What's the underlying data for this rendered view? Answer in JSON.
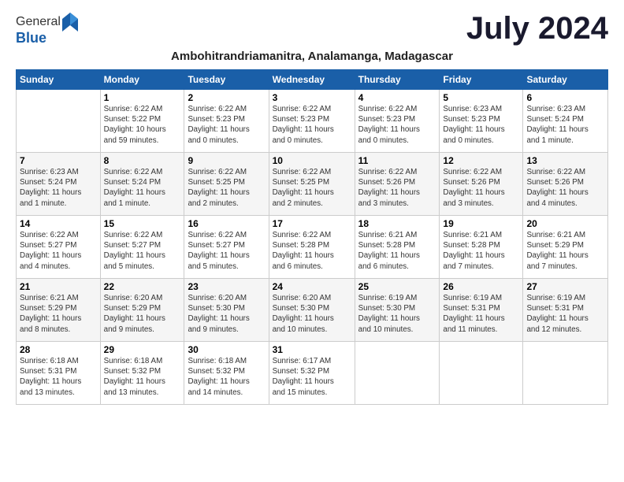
{
  "logo": {
    "general": "General",
    "blue": "Blue"
  },
  "title": "July 2024",
  "subtitle": "Ambohitrandriamanitra, Analamanga, Madagascar",
  "days_of_week": [
    "Sunday",
    "Monday",
    "Tuesday",
    "Wednesday",
    "Thursday",
    "Friday",
    "Saturday"
  ],
  "weeks": [
    [
      {
        "day": "",
        "info": ""
      },
      {
        "day": "1",
        "info": "Sunrise: 6:22 AM\nSunset: 5:22 PM\nDaylight: 10 hours\nand 59 minutes."
      },
      {
        "day": "2",
        "info": "Sunrise: 6:22 AM\nSunset: 5:23 PM\nDaylight: 11 hours\nand 0 minutes."
      },
      {
        "day": "3",
        "info": "Sunrise: 6:22 AM\nSunset: 5:23 PM\nDaylight: 11 hours\nand 0 minutes."
      },
      {
        "day": "4",
        "info": "Sunrise: 6:22 AM\nSunset: 5:23 PM\nDaylight: 11 hours\nand 0 minutes."
      },
      {
        "day": "5",
        "info": "Sunrise: 6:23 AM\nSunset: 5:23 PM\nDaylight: 11 hours\nand 0 minutes."
      },
      {
        "day": "6",
        "info": "Sunrise: 6:23 AM\nSunset: 5:24 PM\nDaylight: 11 hours\nand 1 minute."
      }
    ],
    [
      {
        "day": "7",
        "info": "Sunrise: 6:23 AM\nSunset: 5:24 PM\nDaylight: 11 hours\nand 1 minute."
      },
      {
        "day": "8",
        "info": "Sunrise: 6:22 AM\nSunset: 5:24 PM\nDaylight: 11 hours\nand 1 minute."
      },
      {
        "day": "9",
        "info": "Sunrise: 6:22 AM\nSunset: 5:25 PM\nDaylight: 11 hours\nand 2 minutes."
      },
      {
        "day": "10",
        "info": "Sunrise: 6:22 AM\nSunset: 5:25 PM\nDaylight: 11 hours\nand 2 minutes."
      },
      {
        "day": "11",
        "info": "Sunrise: 6:22 AM\nSunset: 5:26 PM\nDaylight: 11 hours\nand 3 minutes."
      },
      {
        "day": "12",
        "info": "Sunrise: 6:22 AM\nSunset: 5:26 PM\nDaylight: 11 hours\nand 3 minutes."
      },
      {
        "day": "13",
        "info": "Sunrise: 6:22 AM\nSunset: 5:26 PM\nDaylight: 11 hours\nand 4 minutes."
      }
    ],
    [
      {
        "day": "14",
        "info": "Sunrise: 6:22 AM\nSunset: 5:27 PM\nDaylight: 11 hours\nand 4 minutes."
      },
      {
        "day": "15",
        "info": "Sunrise: 6:22 AM\nSunset: 5:27 PM\nDaylight: 11 hours\nand 5 minutes."
      },
      {
        "day": "16",
        "info": "Sunrise: 6:22 AM\nSunset: 5:27 PM\nDaylight: 11 hours\nand 5 minutes."
      },
      {
        "day": "17",
        "info": "Sunrise: 6:22 AM\nSunset: 5:28 PM\nDaylight: 11 hours\nand 6 minutes."
      },
      {
        "day": "18",
        "info": "Sunrise: 6:21 AM\nSunset: 5:28 PM\nDaylight: 11 hours\nand 6 minutes."
      },
      {
        "day": "19",
        "info": "Sunrise: 6:21 AM\nSunset: 5:28 PM\nDaylight: 11 hours\nand 7 minutes."
      },
      {
        "day": "20",
        "info": "Sunrise: 6:21 AM\nSunset: 5:29 PM\nDaylight: 11 hours\nand 7 minutes."
      }
    ],
    [
      {
        "day": "21",
        "info": "Sunrise: 6:21 AM\nSunset: 5:29 PM\nDaylight: 11 hours\nand 8 minutes."
      },
      {
        "day": "22",
        "info": "Sunrise: 6:20 AM\nSunset: 5:29 PM\nDaylight: 11 hours\nand 9 minutes."
      },
      {
        "day": "23",
        "info": "Sunrise: 6:20 AM\nSunset: 5:30 PM\nDaylight: 11 hours\nand 9 minutes."
      },
      {
        "day": "24",
        "info": "Sunrise: 6:20 AM\nSunset: 5:30 PM\nDaylight: 11 hours\nand 10 minutes."
      },
      {
        "day": "25",
        "info": "Sunrise: 6:19 AM\nSunset: 5:30 PM\nDaylight: 11 hours\nand 10 minutes."
      },
      {
        "day": "26",
        "info": "Sunrise: 6:19 AM\nSunset: 5:31 PM\nDaylight: 11 hours\nand 11 minutes."
      },
      {
        "day": "27",
        "info": "Sunrise: 6:19 AM\nSunset: 5:31 PM\nDaylight: 11 hours\nand 12 minutes."
      }
    ],
    [
      {
        "day": "28",
        "info": "Sunrise: 6:18 AM\nSunset: 5:31 PM\nDaylight: 11 hours\nand 13 minutes."
      },
      {
        "day": "29",
        "info": "Sunrise: 6:18 AM\nSunset: 5:32 PM\nDaylight: 11 hours\nand 13 minutes."
      },
      {
        "day": "30",
        "info": "Sunrise: 6:18 AM\nSunset: 5:32 PM\nDaylight: 11 hours\nand 14 minutes."
      },
      {
        "day": "31",
        "info": "Sunrise: 6:17 AM\nSunset: 5:32 PM\nDaylight: 11 hours\nand 15 minutes."
      },
      {
        "day": "",
        "info": ""
      },
      {
        "day": "",
        "info": ""
      },
      {
        "day": "",
        "info": ""
      }
    ]
  ]
}
